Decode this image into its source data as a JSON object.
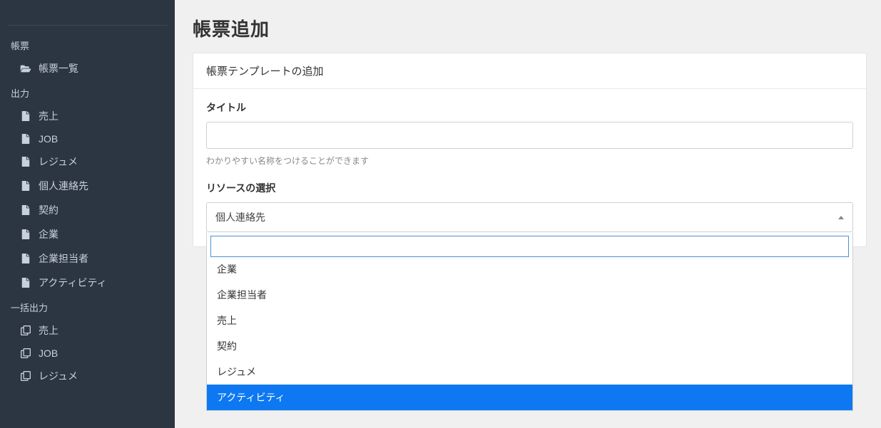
{
  "sidebar": {
    "sections": [
      {
        "header": "帳票",
        "items": [
          {
            "label": "帳票一覧",
            "icon": "folder-open"
          }
        ]
      },
      {
        "header": "出力",
        "items": [
          {
            "label": "売上",
            "icon": "file"
          },
          {
            "label": "JOB",
            "icon": "file"
          },
          {
            "label": "レジュメ",
            "icon": "file"
          },
          {
            "label": "個人連絡先",
            "icon": "file"
          },
          {
            "label": "契約",
            "icon": "file"
          },
          {
            "label": "企業",
            "icon": "file"
          },
          {
            "label": "企業担当者",
            "icon": "file"
          },
          {
            "label": "アクティビティ",
            "icon": "file"
          }
        ]
      },
      {
        "header": "一括出力",
        "items": [
          {
            "label": "売上",
            "icon": "files"
          },
          {
            "label": "JOB",
            "icon": "files"
          },
          {
            "label": "レジュメ",
            "icon": "files"
          }
        ]
      }
    ]
  },
  "main": {
    "page_title": "帳票追加",
    "card_header": "帳票テンプレートの追加",
    "title_field": {
      "label": "タイトル",
      "value": "",
      "help": "わかりやすい名称をつけることができます"
    },
    "resource_field": {
      "label": "リソースの選択",
      "selected": "個人連絡先",
      "search_value": "",
      "options": [
        "企業",
        "企業担当者",
        "売上",
        "契約",
        "レジュメ",
        "アクティビティ"
      ],
      "highlighted_index": 5
    }
  }
}
